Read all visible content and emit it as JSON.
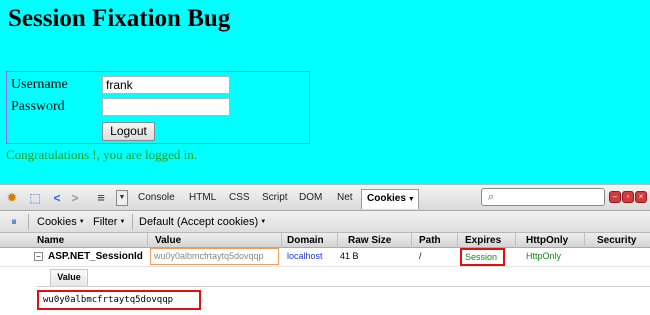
{
  "page": {
    "title": "Session Fixation Bug",
    "username_label": "Username",
    "username_value": "frank",
    "password_label": "Password",
    "password_value": "",
    "logout_label": "Logout",
    "message": "Congratulations !, you are logged in."
  },
  "firebug": {
    "tabs": [
      "Console",
      "HTML",
      "CSS",
      "Script",
      "DOM",
      "Net",
      "Cookies"
    ],
    "active_tab": "Cookies",
    "search_value": "",
    "cookie_toolbar": {
      "cookies_menu": "Cookies",
      "filter_menu": "Filter",
      "default_menu": "Default (Accept cookies)"
    },
    "columns": [
      "Name",
      "Value",
      "Domain",
      "Raw Size",
      "Path",
      "Expires",
      "HttpOnly",
      "Security"
    ],
    "cookie": {
      "name": "ASP.NET_SessionId",
      "value": "wu0y0albmcfrtaytq5dovqqp",
      "domain": "localhost",
      "raw_size": "41 B",
      "path": "/",
      "expires": "Session",
      "httponly": "HttpOnly",
      "security": ""
    },
    "detail_tab": "Value",
    "detail_value": "wu0y0albmcfrtaytq5dovqqp"
  },
  "colors": {
    "page_background": "#00ffff",
    "message_color": "#1a9c1a",
    "highlight_border": "#e01010",
    "domain_color": "#1a3ad8"
  }
}
